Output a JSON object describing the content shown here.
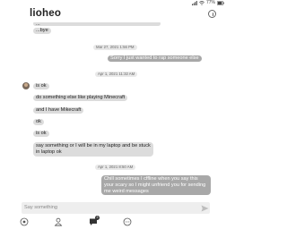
{
  "status_bar": {
    "battery": "77%"
  },
  "header": {
    "title": "lioheo"
  },
  "messages": {
    "cut_top": "...",
    "bye": "...bye",
    "ts1": "Mar 27, 2021 1:56 PM",
    "out1": "Sorry I just wanted to rap someone else",
    "ts2": "Apr 1, 2021 11:32 AM",
    "m1": "is ok",
    "m2": "do something else like playing Minecraft",
    "m3": "and I have Mikecraft",
    "m4": "ok",
    "m5": "is ok",
    "m6": "say something or I will be in my laptop and be stuck in laptop ok",
    "ts3": "Apr 1, 2021 8:50 AM",
    "out2": "Chill sometimes I cffline when you say this your scary so I might unfriend you for sending me weird messages"
  },
  "composer": {
    "placeholder": "Say something"
  },
  "nav": {
    "icons": [
      "home-icon",
      "profile-icon",
      "chat-icon",
      "more-icon"
    ],
    "chat_badge": "3"
  },
  "colors": {
    "incoming_bubble": "#dcdcdc",
    "outgoing_bubble": "#a8a8a8",
    "timestamp_bg": "#e9e9e9"
  }
}
